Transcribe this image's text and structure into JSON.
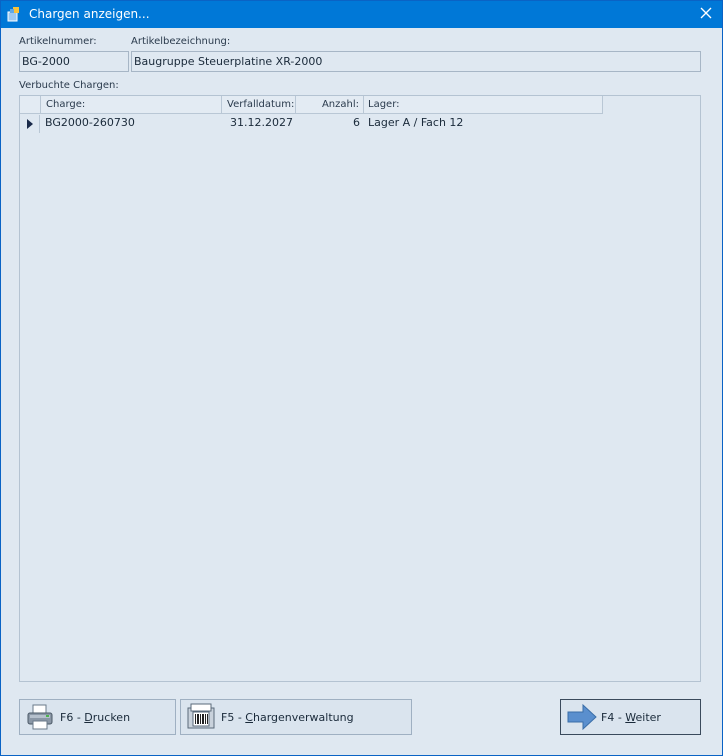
{
  "window": {
    "title": "Chargen anzeigen...",
    "close_icon": "close-icon",
    "app_icon": "app-icon"
  },
  "article": {
    "number_label": "Artikelnummer:",
    "number_value": "BG-2000",
    "description_label": "Artikelbezeichnung:",
    "description_value": "Baugruppe Steuerplatine XR-2000"
  },
  "batches": {
    "section_label": "Verbuchte Chargen:",
    "columns": [
      "Charge:",
      "Verfalldatum:",
      "Anzahl:",
      "Lager:"
    ],
    "rows": [
      {
        "charge": "BG2000-260730",
        "verfalldatum": "31.12.2027",
        "anzahl": "6",
        "lager": "Lager A / Fach 12"
      }
    ]
  },
  "buttons": {
    "print": {
      "prefix": "F6 - ",
      "hotkey": "D",
      "rest": "rucken",
      "icon": "printer-icon"
    },
    "batch_admin": {
      "prefix": "F5 - ",
      "hotkey": "C",
      "rest": "hargenverwaltung",
      "icon": "barcode-scanner-icon"
    },
    "next": {
      "prefix": "F4 - ",
      "hotkey": "W",
      "rest": "eiter",
      "icon": "arrow-right-icon"
    }
  },
  "colors": {
    "titlebar": "#0078d7",
    "background": "#dfe8f1",
    "arrow": "#4f86c6"
  }
}
